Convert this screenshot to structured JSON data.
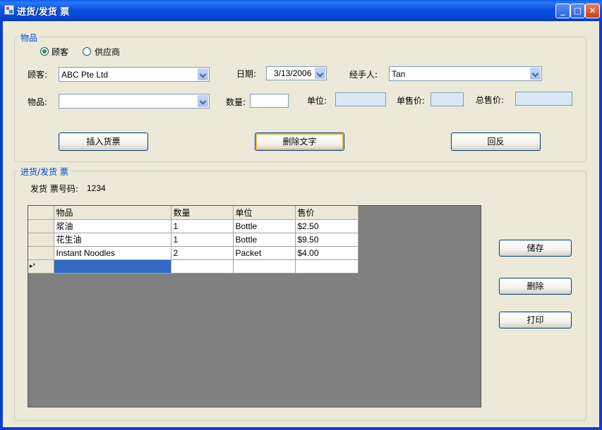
{
  "window": {
    "title": "进货/发货 票",
    "buttons": {
      "minimize": "_",
      "maximize": "□",
      "close": "✕"
    }
  },
  "items_group": {
    "label": "物品",
    "radio_customer": "顾客",
    "radio_supplier": "供应商",
    "customer_label": "顾客:",
    "customer_value": "ABC Pte Ltd",
    "date_label": "日期:",
    "date_value": "3/13/2006",
    "handler_label": "经手人:",
    "handler_value": "Tan",
    "item_label": "物品:",
    "item_value": "",
    "qty_label": "数量:",
    "unit_label": "单位:",
    "unit_price_label": "单售价:",
    "total_price_label": "总售价:",
    "insert_button": "插入货票",
    "delete_text_button": "删除文字",
    "reset_button": "回反"
  },
  "invoice_group": {
    "label": "进货/发货 票",
    "invoice_no_label": "发货 票号码:",
    "invoice_no_value": "1234"
  },
  "grid": {
    "columns": [
      "物品",
      "数量",
      "单位",
      "售价"
    ],
    "rows": [
      [
        "浆油",
        "1",
        "Bottle",
        "$2.50"
      ],
      [
        "花生油",
        "1",
        "Bottle",
        "$9.50"
      ],
      [
        "Instant Noodles",
        "2",
        "Packet",
        "$4.00"
      ]
    ],
    "new_row_marker": "▸*"
  },
  "side_buttons": {
    "save": "储存",
    "delete": "删除",
    "print": "打印"
  }
}
